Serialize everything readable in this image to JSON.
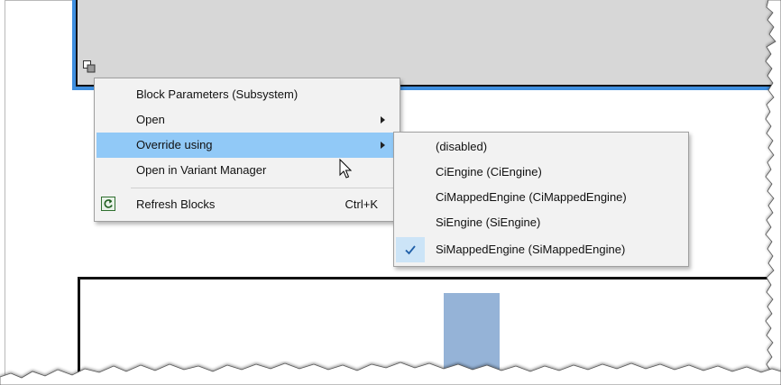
{
  "context_menu": {
    "items": [
      {
        "label": "Block Parameters (Subsystem)"
      },
      {
        "label": "Open",
        "submenu_arrow": true
      },
      {
        "label": "Override using",
        "submenu_arrow": true,
        "active": true
      },
      {
        "label": "Open in Variant Manager"
      },
      {
        "label": "Refresh Blocks",
        "shortcut": "Ctrl+K",
        "icon": "refresh-icon"
      }
    ]
  },
  "override_submenu": {
    "items": [
      {
        "label": "(disabled)"
      },
      {
        "label": "CiEngine (CiEngine)"
      },
      {
        "label": "CiMappedEngine (CiMappedEngine)"
      },
      {
        "label": "SiEngine (SiEngine)"
      },
      {
        "label": "SiMappedEngine (SiMappedEngine)",
        "checked": true
      }
    ]
  },
  "colors": {
    "menu_bg": "#f2f2f2",
    "highlight": "#91c9f7",
    "selection_border": "#3f8fdf",
    "block_fill": "#d7d7d7",
    "signal_fill": "#95b3d7"
  },
  "icons": {
    "variant_badge": "variant-subsystem-icon",
    "refresh": "refresh-icon",
    "check": "checkmark-icon",
    "cursor": "mouse-pointer-icon",
    "submenu_arrow": "chevron-right-icon"
  }
}
